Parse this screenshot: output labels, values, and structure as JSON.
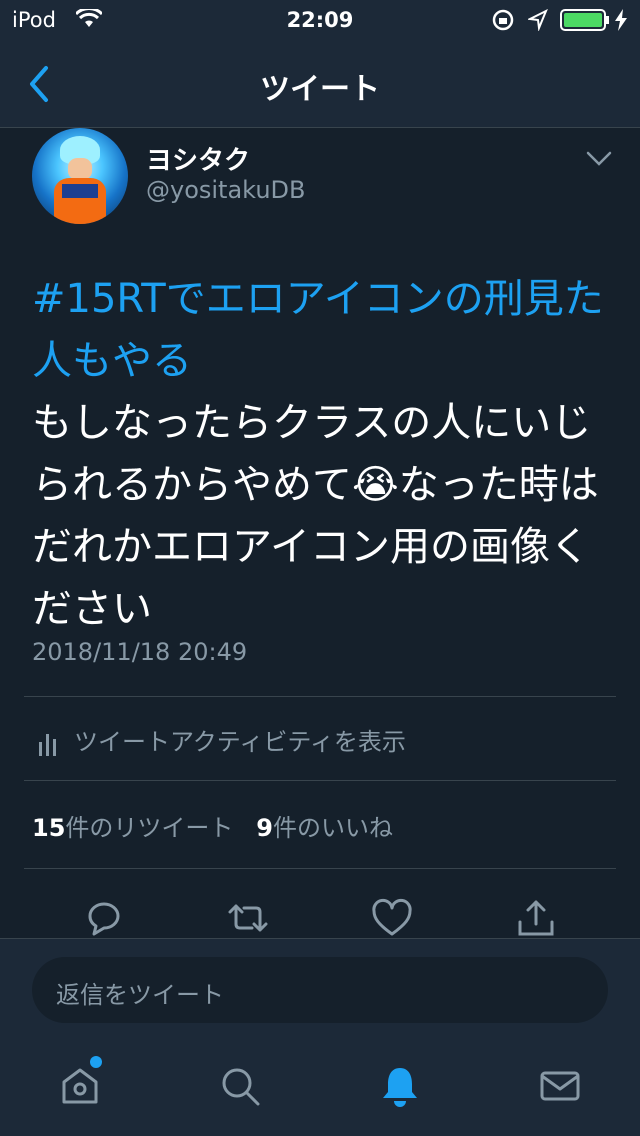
{
  "status_bar": {
    "carrier": "iPod",
    "time": "22:09"
  },
  "nav": {
    "title": "ツイート"
  },
  "tweet": {
    "display_name": "ヨシタク",
    "handle": "@yositakuDB",
    "hashtag_line": "#15RTでエロアイコンの刑見た人もやる",
    "body_text": "もしなったらクラスの人にいじられるからやめて😭なった時はだれかエロアイコン用の画像ください",
    "timestamp": "2018/11/18 20:49"
  },
  "activity": {
    "label": "ツイートアクティビティを表示"
  },
  "stats": {
    "retweet_count": "15",
    "retweet_label": "件のリツイート",
    "like_count": "9",
    "like_label": "件のいいね"
  },
  "reply": {
    "placeholder": "返信をツイート"
  },
  "icons": {
    "back": "chevron-left-icon",
    "menu": "chevron-down-icon",
    "reply": "reply-icon",
    "retweet": "retweet-icon",
    "like": "heart-icon",
    "share": "share-icon",
    "home": "home-icon",
    "search": "search-icon",
    "notifications": "bell-icon",
    "messages": "mail-icon"
  },
  "colors": {
    "background": "#15202b",
    "bar": "#1c2938",
    "accent": "#1da1f2",
    "muted": "#8899a6",
    "battery": "#4cd964"
  }
}
